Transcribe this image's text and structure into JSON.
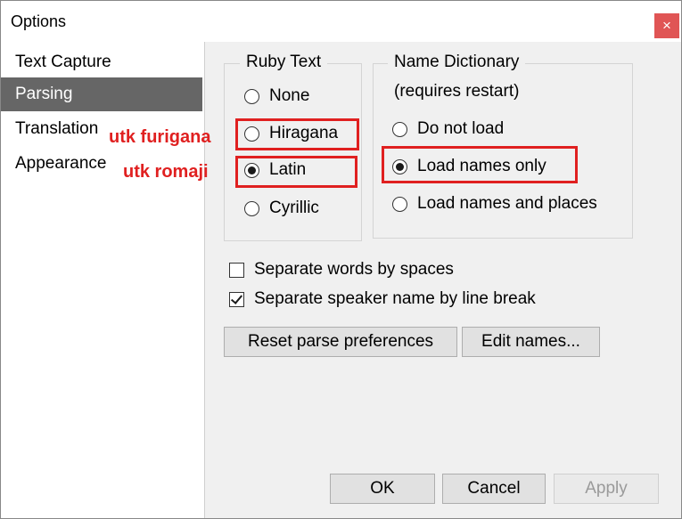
{
  "window": {
    "title": "Options",
    "close_label": "×"
  },
  "sidebar": {
    "items": [
      {
        "label": "Text Capture",
        "selected": false
      },
      {
        "label": "Parsing",
        "selected": true
      },
      {
        "label": "Translation",
        "selected": false
      },
      {
        "label": "Appearance",
        "selected": false
      }
    ]
  },
  "ruby_text": {
    "title": "Ruby Text",
    "options": [
      "None",
      "Hiragana",
      "Latin",
      "Cyrillic"
    ],
    "selected": "Latin"
  },
  "name_dictionary": {
    "title": "Name Dictionary",
    "subtitle": "(requires restart)",
    "options": [
      "Do not load",
      "Load names only",
      "Load names and places"
    ],
    "selected": "Load names only"
  },
  "checkboxes": {
    "separate_words": {
      "label": "Separate words by spaces",
      "checked": false
    },
    "separate_speaker": {
      "label": "Separate speaker name by line break",
      "checked": true
    }
  },
  "buttons": {
    "reset": "Reset parse preferences",
    "edit_names": "Edit names...",
    "ok": "OK",
    "cancel": "Cancel",
    "apply": "Apply"
  },
  "annotations": {
    "furigana": "utk furigana",
    "romaji": "utk romaji",
    "highlight_color": "#e02020"
  }
}
